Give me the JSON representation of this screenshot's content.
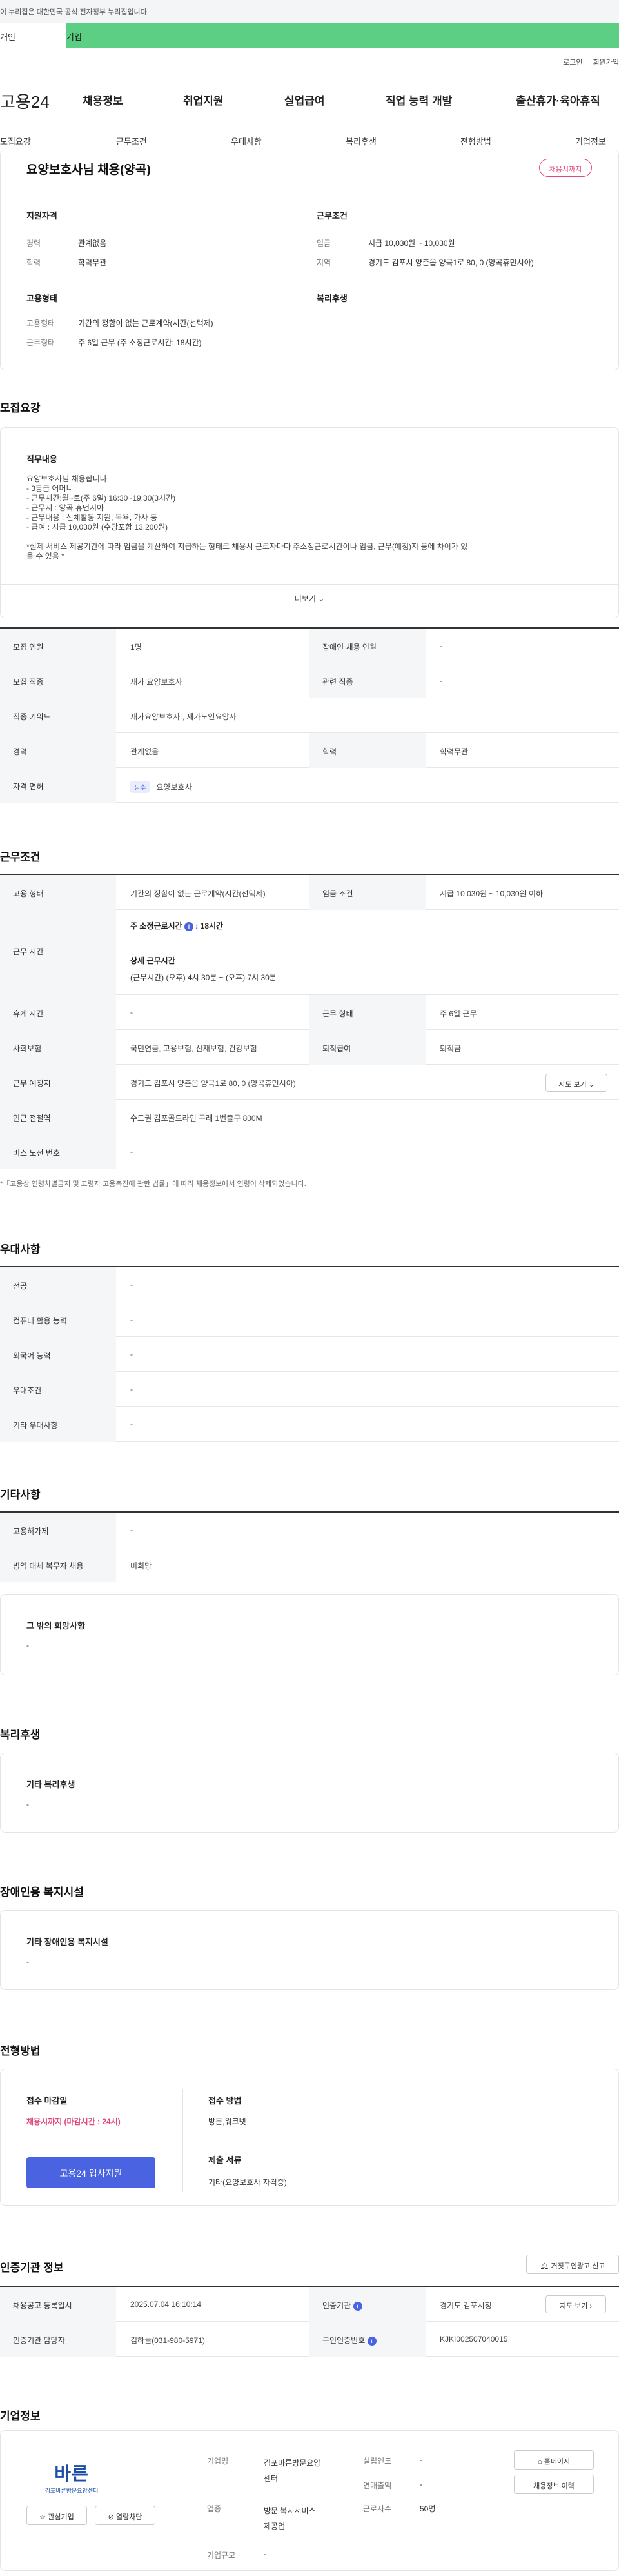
{
  "gov_banner": "이 누리집은 대한민국 공식 전자정부 누리집입니다.",
  "tabs": [
    "개인",
    "기업"
  ],
  "util": [
    "로그인",
    "회원가입"
  ],
  "logo": "고용24",
  "gnb": [
    "채용정보",
    "취업지원",
    "실업급여",
    "직업 능력 개발",
    "출산휴가·육아휴직"
  ],
  "subnav": [
    "모집요강",
    "근무조건",
    "우대사항",
    "복리후생",
    "전형방법",
    "기업정보"
  ],
  "summary": {
    "title": "요양보호사님 채용(양곡)",
    "status": "채용시까지",
    "qual_title": "지원자격",
    "qual": [
      {
        "k": "경력",
        "v": "관계없음"
      },
      {
        "k": "학력",
        "v": "학력무관"
      }
    ],
    "cond_title": "근무조건",
    "cond": [
      {
        "k": "임금",
        "v": "시급 10,030원 ~ 10,030원"
      },
      {
        "k": "지역",
        "v": "경기도 김포시 양촌읍 양곡1로 80, 0 (양곡휴먼시아)"
      }
    ],
    "type_title": "고용형태",
    "type": [
      {
        "k": "고용형태",
        "v": "기간의 정함이 없는 근로계약(시간(선택제)"
      },
      {
        "k": "근무형태",
        "v": "주 6일 근무 (주 소정근로시간: 18시간)"
      }
    ],
    "welfare_title": "복리후생"
  },
  "recruit": {
    "heading": "모집요강",
    "job_title": "직무내용",
    "job_lines": [
      "요양보호사님 채용합니다.",
      "- 3등급 어머니",
      "- 근무시간:월~토(주 6일) 16:30~19:30(3시간)",
      "- 근무지 : 양곡 휴먼시아",
      "- 근무내용 : 신체활동 지원, 목욕, 가사 등",
      "- 급여 : 시급 10,030원 (수당포함 13,200원)",
      "",
      "*실제 서비스 제공기간에 따라 임금을 계산하여 지급하는 형태로 채용시 근로자마다 주소정근로시간이나 임금, 근무(예정)지 등에 차이가 있",
      "을 수 있음 *"
    ],
    "more": "더보기",
    "rows": [
      {
        "k": "모집 인원",
        "v": "1명",
        "k2": "장애인 채용 인원",
        "v2": "-"
      },
      {
        "k": "모집 직종",
        "v": "재가 요양보호사",
        "k2": "관련 직종",
        "v2": "-"
      },
      {
        "k": "직종 키워드",
        "v": "재가요양보호사 , 재가노인요양사"
      },
      {
        "k": "경력",
        "v": "관계없음",
        "k2": "학력",
        "v2": "학력무관"
      },
      {
        "k": "자격 면허",
        "tag": "필수",
        "v": "요양보호사"
      }
    ]
  },
  "work": {
    "heading": "근무조건",
    "r1": {
      "k": "고용 형태",
      "v": "기간의 정함이 없는 근로계약(시간(선택제)",
      "k2": "임금 조건",
      "v2": "시급 10,030원 ~ 10,030원 이하"
    },
    "time_k": "근무 시간",
    "weekly_label": "주 소정근로시간",
    "weekly_val": "18시간",
    "detail_label": "상세 근무시간",
    "detail_val": "(근무시간) (오후) 4시 30분 ~ (오후) 7시 30분",
    "r3": {
      "k": "휴게 시간",
      "v": "-",
      "k2": "근무 형태",
      "v2": "주 6일 근무"
    },
    "r4": {
      "k": "사회보험",
      "v": "국민연금, 고용보험, 산재보험, 건강보험",
      "k2": "퇴직급여",
      "v2": "퇴직금"
    },
    "r5": {
      "k": "근무 예정지",
      "v": "경기도 김포시 양촌읍 양곡1로 80, 0 (양곡휴먼시아)",
      "btn": "지도 보기"
    },
    "r6": {
      "k": "인근 전철역",
      "v": "수도권 김포골드라인 구래 1번출구 800M"
    },
    "r7": {
      "k": "버스 노선 번호",
      "v": "-"
    },
    "note": "*「고용상 연령차별금지 및 고령자 고용촉진에 관한 법률」에 따라 채용정보에서 연령이 삭제되었습니다."
  },
  "pref": {
    "heading": "우대사항",
    "rows": [
      {
        "k": "전공",
        "v": "-"
      },
      {
        "k": "컴퓨터 활용 능력",
        "v": "-"
      },
      {
        "k": "외국어 능력",
        "v": "-"
      },
      {
        "k": "우대조건",
        "v": "-"
      },
      {
        "k": "기타 우대사항",
        "v": "-"
      }
    ]
  },
  "etc": {
    "heading": "기타사항",
    "rows": [
      {
        "k": "고용허가제",
        "v": "-"
      },
      {
        "k": "병역 대체 복무자 채용",
        "v": "비희망"
      }
    ],
    "box_title": "그 밖의 희망사항",
    "box_val": "-"
  },
  "welfare": {
    "heading": "복리후생",
    "box_title": "기타 복리후생",
    "box_val": "-"
  },
  "disab": {
    "heading": "장애인용 복지시설",
    "box_title": "기타 장애인용 복지시설",
    "box_val": "-"
  },
  "process": {
    "heading": "전형방법",
    "deadline_title": "접수 마감일",
    "deadline_val": "채용시까지 (마감시간 : 24시)",
    "apply_btn": "고용24 입사지원",
    "method_title": "접수 방법",
    "method_val": "방문,워크넷",
    "docs_title": "제출 서류",
    "docs_val": "기타(요양보호사 자격증)"
  },
  "agency": {
    "heading": "인증기관 정보",
    "report_btn": "거짓구인광고 신고",
    "r1": {
      "k": "채용공고 등록일시",
      "v": "2025.07.04 16:10:14",
      "k2": "인증기관",
      "v2": "경기도 김포시청",
      "btn": "지도 보기"
    },
    "r2": {
      "k": "인증기관 담당자",
      "v": "김하늘(031-980-5971)",
      "k2": "구인인증번호",
      "v2": "KJKI002507040015"
    }
  },
  "company": {
    "heading": "기업정보",
    "logo_text": "김포바른방문요양센터",
    "fav_btn": "관심기업",
    "block_btn": "열람차단",
    "k1": "기업명",
    "v1": [
      "김포바른방문요양",
      "센터"
    ],
    "k2": "업종",
    "v2": [
      "방문 복지서비스",
      "제공업"
    ],
    "k3": "기업규모",
    "v3": "-",
    "k4": "설립연도",
    "v4": "-",
    "k5": "연매출액",
    "v5": "-",
    "k6": "근로자수",
    "v6": "50명",
    "homepage_btn": "홈페이지",
    "history_btn": "채용정보 이력"
  },
  "colors": {
    "accent": "#5ccf85",
    "red": "#e04a7a",
    "blue": "#4a63e0"
  }
}
